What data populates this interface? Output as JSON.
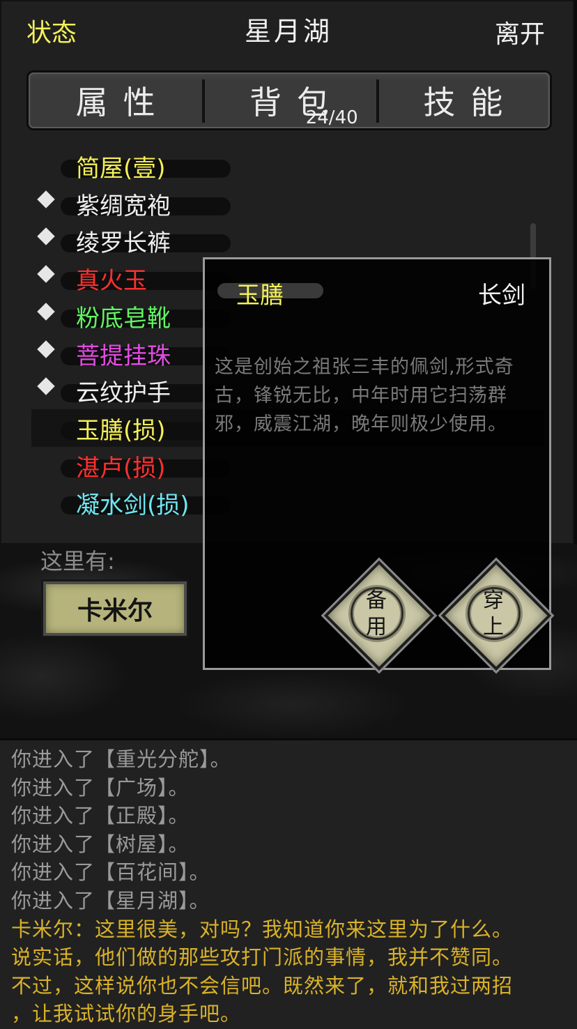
{
  "header": {
    "status_label": "状态",
    "location_title": "星月湖",
    "leave_label": "离开"
  },
  "tabs": [
    {
      "label": "属性"
    },
    {
      "label": "背包",
      "count": "24/40"
    },
    {
      "label": "技能"
    }
  ],
  "inventory": [
    {
      "name": "简屋(壹)",
      "color": "#f4f05a",
      "equipped": false
    },
    {
      "name": "紫绸宽袍",
      "color": "#efefef",
      "equipped": true
    },
    {
      "name": "绫罗长裤",
      "color": "#efefef",
      "equipped": true
    },
    {
      "name": "真火玉",
      "color": "#ff3030",
      "equipped": true
    },
    {
      "name": "粉底皂靴",
      "color": "#63f363",
      "equipped": true
    },
    {
      "name": "菩提挂珠",
      "color": "#e04de0",
      "equipped": true
    },
    {
      "name": "云纹护手",
      "color": "#efefef",
      "equipped": true
    },
    {
      "name": "玉膳(损)",
      "color": "#f4f05a",
      "equipped": false,
      "selected": true
    },
    {
      "name": "湛卢(损)",
      "color": "#ff3030",
      "equipped": false
    },
    {
      "name": "凝水剑(损)",
      "color": "#6ee6f2",
      "equipped": false
    }
  ],
  "scene": {
    "here_label": "这里有:",
    "npc_name": "卡米尔"
  },
  "popup": {
    "item_name": "玉膳",
    "item_type": "长剑",
    "description": "这是创始之祖张三丰的佩剑,形式奇古，锋锐无比，中年时用它扫荡群邪，威震江湖，晚年则极少使用。",
    "reserve_label": [
      "备",
      "用"
    ],
    "equip_label": [
      "穿",
      "上"
    ]
  },
  "log": [
    {
      "text": "你进入了【重光分舵】。",
      "type": "system"
    },
    {
      "text": "你进入了【广场】。",
      "type": "system"
    },
    {
      "text": "你进入了【正殿】。",
      "type": "system"
    },
    {
      "text": "你进入了【树屋】。",
      "type": "system"
    },
    {
      "text": "你进入了【百花间】。",
      "type": "system"
    },
    {
      "text": "你进入了【星月湖】。",
      "type": "system"
    },
    {
      "text": "卡米尔：这里很美，对吗？我知道你来这里为了什么。",
      "type": "npc"
    },
    {
      "text": "说实话，他们做的那些攻打门派的事情，我并不赞同。",
      "type": "npc"
    },
    {
      "text": "不过，这样说你也不会信吧。既然来了，就和我过两招",
      "type": "npc"
    },
    {
      "text": "，让我试试你的身手吧。",
      "type": "npc"
    }
  ]
}
